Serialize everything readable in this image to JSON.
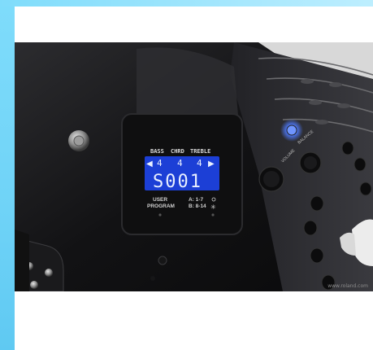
{
  "display": {
    "header": [
      "BASS",
      "CHRD",
      "TREBLE"
    ],
    "values": [
      "4",
      "4",
      "4"
    ],
    "readout": "S001",
    "user_label": "USER",
    "program_label": "PROGRAM",
    "bank_a": "A: 1-7",
    "bank_b": "B: 8-14"
  },
  "panel": {
    "volume_label": "VOLUME",
    "balance_label": "BALANCE"
  },
  "watermark": "www.roland.com",
  "colors": {
    "lcd_background": "#1c3fd6",
    "lcd_text": "#e9f0ff",
    "led": "#4f7bff",
    "side_accent": "#6fd3f7"
  }
}
